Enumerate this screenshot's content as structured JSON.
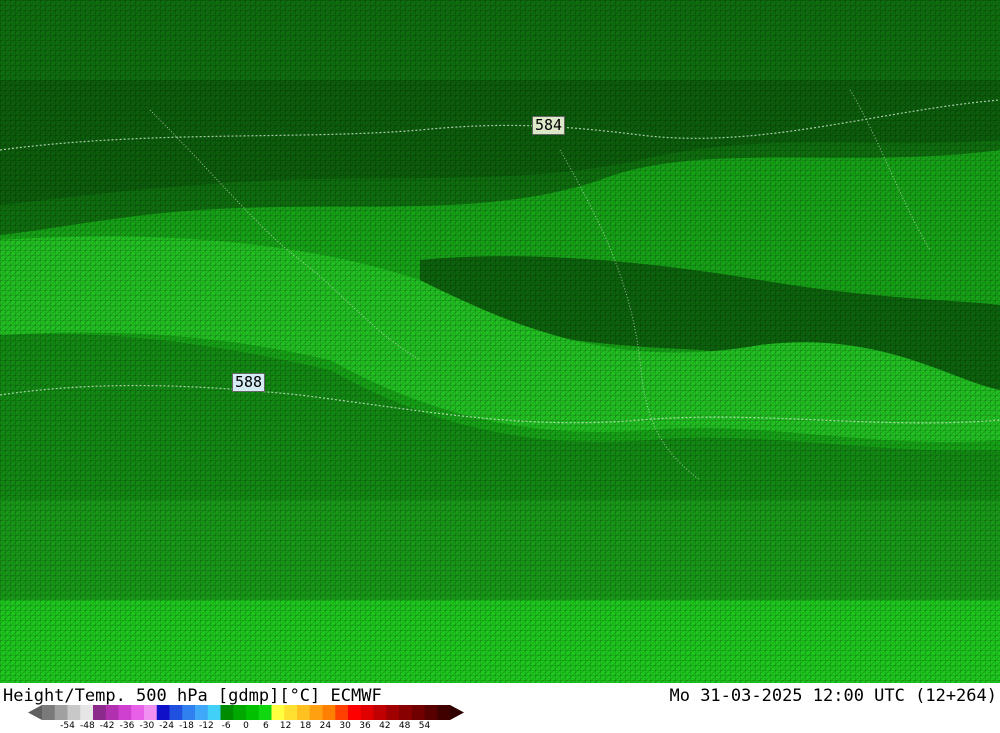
{
  "map": {
    "contour_labels": [
      "584",
      "588"
    ],
    "colors": {
      "base": "#17a317",
      "dark": "#0c5e0c",
      "mid": "#127f12",
      "light": "#22c022",
      "bright": "#1ec81e"
    }
  },
  "footer": {
    "title": "Height/Temp. 500 hPa [gdmp][°C] ECMWF",
    "datetime": "Mo 31-03-2025 12:00 UTC (12+264)"
  },
  "colorbar": {
    "ticks": [
      "-54",
      "-48",
      "-42",
      "-36",
      "-30",
      "-24",
      "-18",
      "-12",
      "-6",
      "0",
      "6",
      "12",
      "18",
      "24",
      "30",
      "36",
      "42",
      "48",
      "54"
    ],
    "colors": [
      "#7a7a7a",
      "#a0a0a0",
      "#c8c8c8",
      "#e6e6e6",
      "#8c2a8c",
      "#b030b0",
      "#d040d0",
      "#e860e8",
      "#f090f0",
      "#1010c8",
      "#2050e0",
      "#3080f0",
      "#40a8f8",
      "#40d0f8",
      "#008c00",
      "#00a800",
      "#00c000",
      "#10d810",
      "#ffff40",
      "#ffe030",
      "#ffc020",
      "#ffa010",
      "#ff8000",
      "#ff4000",
      "#ff0000",
      "#e00000",
      "#c00000",
      "#a00000",
      "#880000",
      "#700000",
      "#580000",
      "#400000"
    ]
  }
}
